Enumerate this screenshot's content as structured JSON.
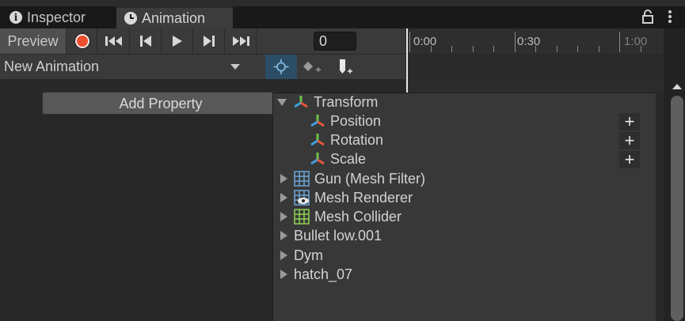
{
  "tabs": [
    {
      "label": "Inspector",
      "icon": "info-icon"
    },
    {
      "label": "Animation",
      "icon": "clock-icon"
    }
  ],
  "toolbar": {
    "preview_label": "Preview",
    "frame_value": "0",
    "record_color": "#f04f2f"
  },
  "timeline": {
    "labels": [
      "0:00",
      "0:30",
      "1:00"
    ]
  },
  "clip": {
    "name": "New Animation"
  },
  "add_property_label": "Add Property",
  "properties": {
    "transform": "Transform",
    "position": "Position",
    "rotation": "Rotation",
    "scale": "Scale",
    "mesh_filter": "Gun (Mesh Filter)",
    "mesh_renderer": "Mesh Renderer",
    "mesh_collider": "Mesh Collider",
    "child_1": "Bullet low.001",
    "child_2": "Dym",
    "child_3": "hatch_07",
    "plus": "+"
  },
  "colors": {
    "keyframe_filter_active": "#2b4e66",
    "grid_icon": "#6aa6d9",
    "collider_icon": "#8fd14f"
  }
}
